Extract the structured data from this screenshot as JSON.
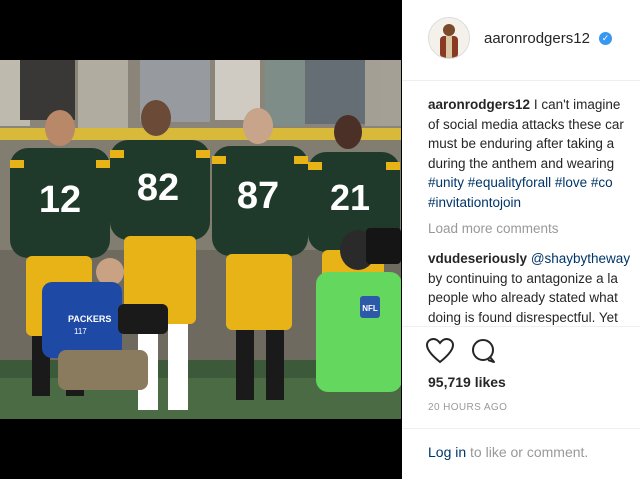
{
  "post": {
    "username": "aaronrodgers12",
    "verified": true,
    "caption": {
      "username": "aaronrodgers12",
      "line1": "I can't imagine",
      "line2": "of social media attacks these car",
      "line3": "must be enduring after taking a",
      "line4": "during the anthem and wearing",
      "hashtags_line1": [
        "#unity",
        "#equalityforall",
        "#love",
        "#co"
      ],
      "hashtags_line2": [
        "#invitationtojoin"
      ]
    },
    "load_more_label": "Load more comments",
    "comment": {
      "username": "vdudeseriously",
      "mention": "@shaybytheway",
      "line2": "by continuing to antagonize a la",
      "line3": "people who already stated what",
      "line4": "doing is found disrespectful. Yet"
    },
    "likes": "95,719 likes",
    "timestamp": "20 HOURS AGO"
  },
  "footer": {
    "login_link": "Log in",
    "login_suffix": " to like or comment."
  },
  "photo": {
    "jersey_numbers": [
      "12",
      "82",
      "87",
      "21"
    ],
    "camera_vest_text": "PACKERS",
    "camera_vest_subtext": "117",
    "nfl_logo_text": "NFL"
  },
  "colors": {
    "jersey_green": "#1f3a2a",
    "pants_gold": "#e8b316",
    "link": "#003569",
    "verified": "#3897f0"
  }
}
